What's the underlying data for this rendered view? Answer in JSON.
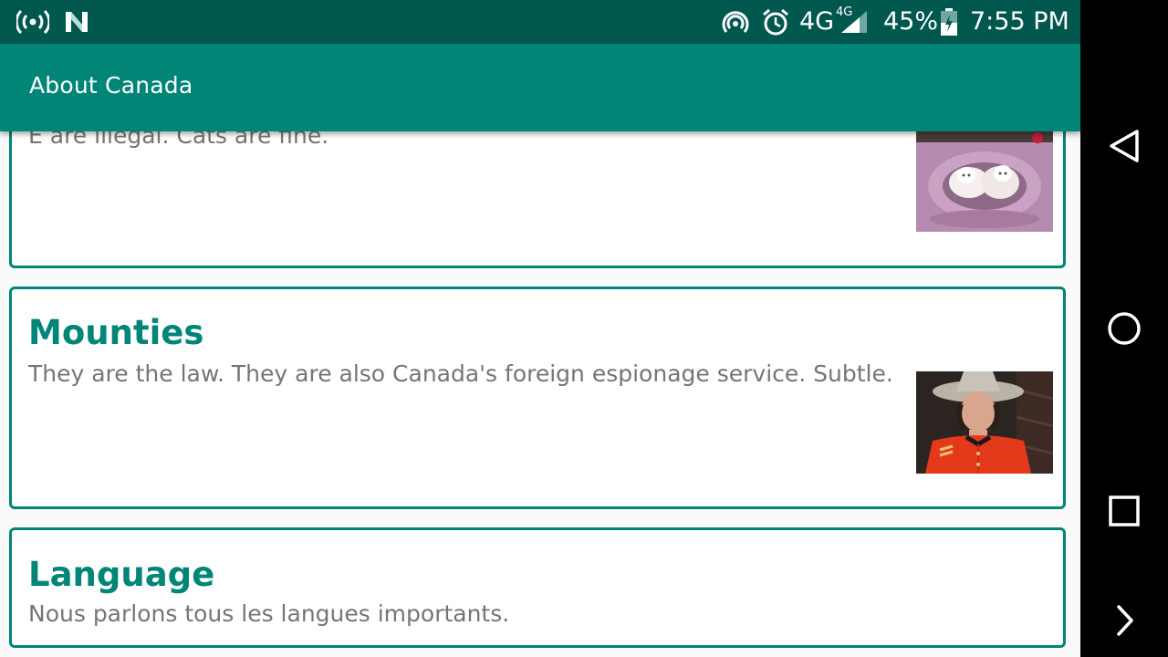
{
  "status_bar": {
    "network_type": "4G",
    "network_type_small": "4G",
    "battery_percent": "45%",
    "time": "7:55 PM"
  },
  "app_bar": {
    "title": "About Canada"
  },
  "cards": [
    {
      "title": "",
      "text": "E are illegal. Cats are fine."
    },
    {
      "title": "Mounties",
      "text": "They are the law. They are also Canada's foreign espionage service. Subtle."
    },
    {
      "title": "Language",
      "text": "Nous parlons tous les langues importants."
    }
  ],
  "nav_bar": {
    "buttons": [
      "back-icon",
      "home-icon",
      "recents-icon",
      "next-icon"
    ]
  },
  "colors": {
    "status_bar": "#00574e",
    "primary": "#008577",
    "text_secondary": "#757575",
    "background": "#fafafa"
  }
}
